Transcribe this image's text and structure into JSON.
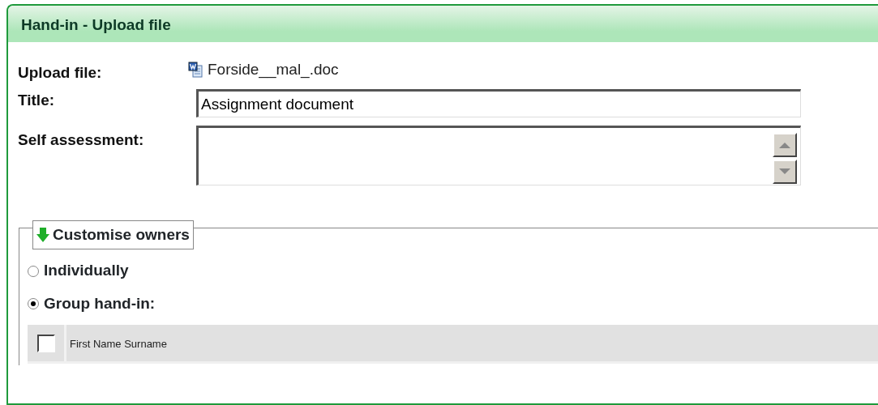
{
  "panel": {
    "title": "Hand-in - Upload file"
  },
  "upload_file": {
    "label": "Upload file:",
    "file_name": "Forside__mal_.doc"
  },
  "title_field": {
    "label": "Title:",
    "value": "Assignment document"
  },
  "self_assessment": {
    "label": "Self assessment:"
  },
  "owners": {
    "legend": "Customise owners",
    "expanded": true,
    "options": [
      {
        "label": "Individually",
        "selected": false
      },
      {
        "label": "Group hand-in:",
        "selected": true
      }
    ],
    "members": [
      {
        "name": "First Name Surname",
        "checked": false
      }
    ]
  }
}
